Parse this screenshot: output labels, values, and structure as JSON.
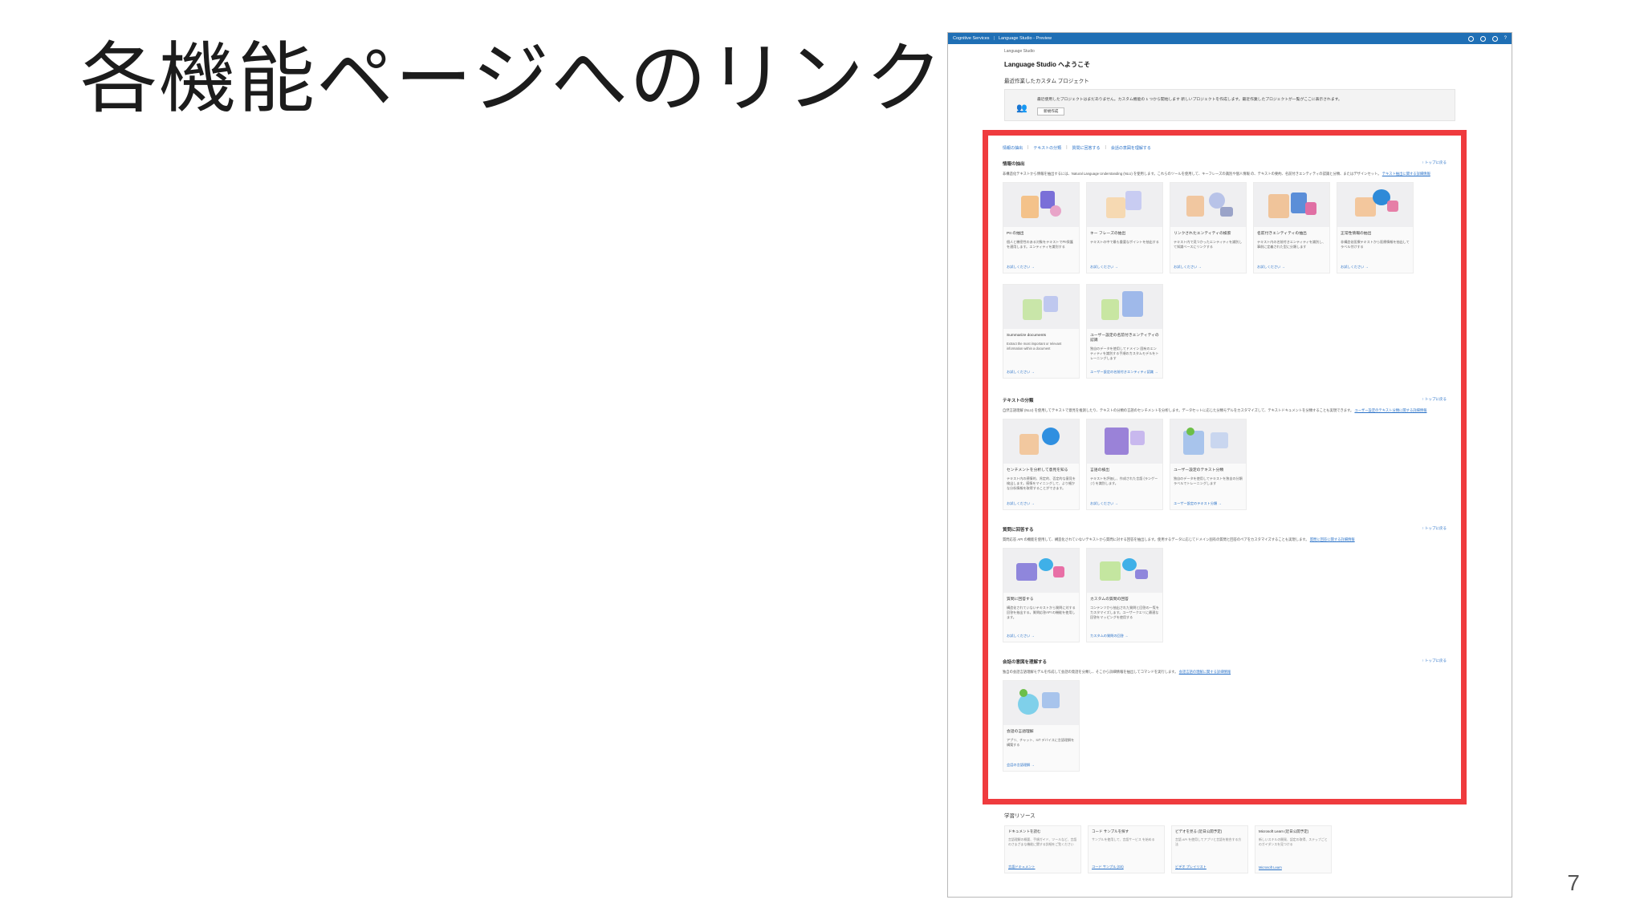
{
  "slide": {
    "title": "各機能ページへのリンク",
    "page_number": "7"
  },
  "topbar": {
    "service": "Cognitive Services",
    "separator": "|",
    "product": "Language Studio - Preview"
  },
  "header": {
    "breadcrumb": "Language Studio",
    "welcome": "Language Studio へようこそ"
  },
  "recent": {
    "heading": "最近作業したカスタム プロジェクト",
    "empty_text": "最近使用したプロジェクトはまだありません。カスタム機能の 1 つから開始します 新しいプロジェクトを作成します。最近作業したプロジェクトが一覧がここに表示されます。",
    "new_button": "新規作成"
  },
  "nav": {
    "links": [
      "情報の抽出",
      "テキストの分類",
      "質問に回答する",
      "会話の意図を理解する"
    ],
    "separator": "|"
  },
  "sections": [
    {
      "title": "情報の抽出",
      "back_to_top": "↑ トップに戻る",
      "desc": "非構造化テキストから情報を抽出するには、Natural Language Understanding (NLU) を使用します。これらのツールを使用して、キーフレーズの識別や個人情報 の、テキストの要約、名前付きエンティティの認識と分類、またはデザインセット。",
      "desc_link": "テキスト抽出に関する詳細情報",
      "cards": [
        {
          "name": "PII の抽出",
          "desc": "個人と機密性のある対象をテキストでPII保護を適用します。エンティティを識別する",
          "try": "お試しください →"
        },
        {
          "name": "キー フレーズの抽出",
          "desc": "テキストの中で最も重要なポイントを抽出する",
          "try": "お試しください →"
        },
        {
          "name": "リンクされたエンティティの検索",
          "desc": "テキスト内で見つかったエンティティを識別して知識ベースにリンクする",
          "try": "お試しください →"
        },
        {
          "name": "名前付きエンティティの抽出",
          "desc": "テキスト内の名前付きエンティティを識別し、事前に定義された型に分類します",
          "try": "お試しください →"
        },
        {
          "name": "正常性情報の抽出",
          "desc": "非構造化医療テキストから医療情報を抽出してラベル付けする",
          "try": "お試しください →"
        },
        {
          "name": "Summarize documents",
          "desc": "Extract the most important or relevant information within a document",
          "try": "お試しください →"
        },
        {
          "name": "ユーザー設定の名前付きエンティティの認識",
          "desc": "独自のデータを使用してドメイン 固有のエンティティを識別する手順のカスタムモデルをトレーニングします",
          "try": "ユーザー設定の名前付きエンティティ認識 →"
        }
      ]
    },
    {
      "title": "テキストの分類",
      "back_to_top": "↑ トップに戻る",
      "desc": "自然言語理解 (NLU) を使用してテキストで意見を推測したり、テキストの分類の言語のセンチメントを分析します。データセットに応じた分類モデルをカスタマイズして、テキストドキュメントを分類することも実現できます。",
      "desc_link": "ユーザー設定のテキスト分類に関する詳細情報",
      "cards": [
        {
          "name": "センチメントを分析して意見を知る",
          "desc": "テキスト内の感情的、肯定的、否定的な意見を検出します。感情をマイニングして、より細かな分析情報を取得することができます。",
          "try": "お試しください →"
        },
        {
          "name": "言語の検出",
          "desc": "テキストを評価し、作成された言語 (ランゲージ) を識別します。",
          "try": "お試しください →"
        },
        {
          "name": "ユーザー設定のテキスト分類",
          "desc": "独自のデータを使用してテキストを独自の分類ラベルでトレーニングします",
          "try": "ユーザー設定のテキスト分類 →"
        }
      ]
    },
    {
      "title": "質問に回答する",
      "back_to_top": "↑ トップに戻る",
      "desc": "質問応答 API の機能を使用して、構造化されていないテキストから質問に対する回答を抽出します。使用するデータに応じてドメイン固有の質問と回答のペアをカスタマイズすることも実現します。",
      "desc_link": "質問に回答に関する詳細情報",
      "cards": [
        {
          "name": "質問に回答する",
          "desc": "構造化されていないテキストから質問に対する回答を抽出する。質問応答API の機能を使用します。",
          "try": "お試しください →"
        },
        {
          "name": "カスタムの質問の回答",
          "desc": "コンテンツから抽出された質問と回答の一覧をカスタマイズします。ユーザークエリに最適な回答をマッピングを使用する",
          "try": "カスタムの質問の回答 →"
        }
      ]
    },
    {
      "title": "会話の意図を理解する",
      "back_to_top": "↑ トップに戻る",
      "desc": "独自の会話言語理解モデルを作成して会話の発話を分類し、そこから詳細情報を抽出してコマンドを実行します。",
      "desc_link": "会話言語の理解に関する詳細情報",
      "cards": [
        {
          "name": "会話の言語理解",
          "desc": "アプリ、チャット、IoT デバイスに言語理解を構築する",
          "try": "会話の言語理解 →"
        }
      ]
    }
  ],
  "learning": {
    "heading": "学習リソース",
    "cards": [
      {
        "title": "ドキュメントを読む",
        "desc": "言語理解の概要、手順ガイド、ツールなど、言語のさまざまな機能に関する詳細をご覧ください",
        "link": "言語ドキュメント"
      },
      {
        "title": "コード サンプルを探す",
        "desc": "サンプルを使用して、言語サービス を始める",
        "link": "コード サンプル (Git)"
      },
      {
        "title": "ビデオを見る (近日公開予定)",
        "desc": "言語 API を使用してアプリと言語を統合する方法",
        "link": "ビデオ プレイリスト"
      },
      {
        "title": "Microsoft Learn (近日公開予定)",
        "desc": "新しいスキルの開発、認定の取得、ステップごとのガイダンスを見つける",
        "link": "Microsoft Learn"
      }
    ]
  }
}
